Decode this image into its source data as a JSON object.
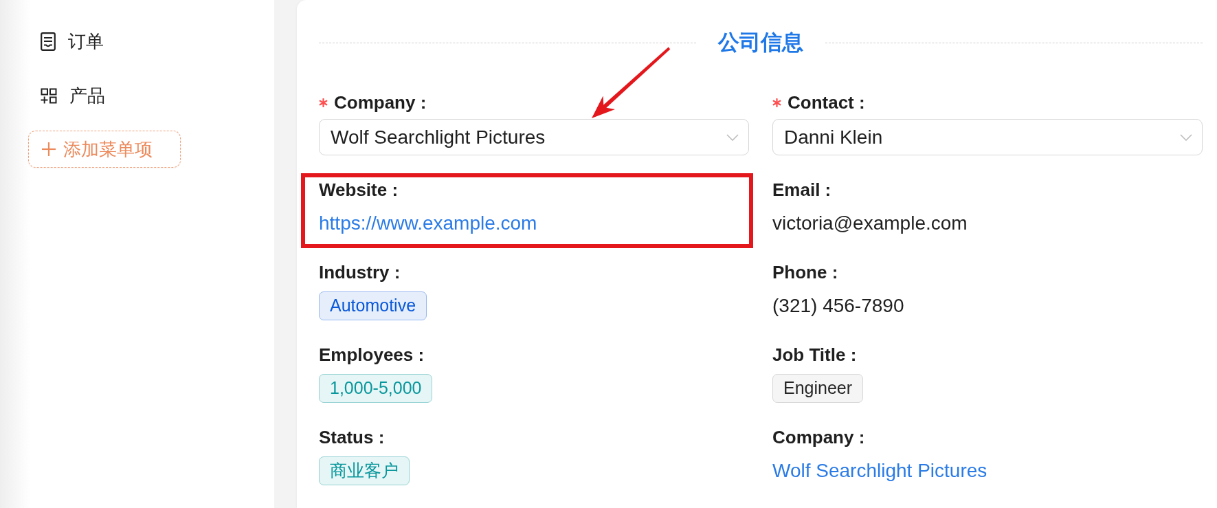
{
  "sidebar": {
    "items": [
      {
        "label": "订单",
        "selected": false
      },
      {
        "label": "产品",
        "selected": false
      }
    ],
    "add_button": {
      "label": "添加菜单项"
    }
  },
  "section": {
    "title": "公司信息"
  },
  "fields": [
    {
      "label": "Company :",
      "required": true,
      "kind": "select",
      "value": "Wolf Searchlight Pictures",
      "highlighted": false,
      "pointed_at": true
    },
    {
      "label": "Contact :",
      "required": true,
      "kind": "select",
      "value": "Danni Klein",
      "highlighted": false,
      "pointed_at": false
    },
    {
      "label": "Website :",
      "required": false,
      "kind": "link",
      "value": "https://www.example.com",
      "highlighted": true,
      "pointed_at": false
    },
    {
      "label": "Email :",
      "required": false,
      "kind": "text",
      "value": "victoria@example.com",
      "highlighted": false,
      "pointed_at": false
    },
    {
      "label": "Industry :",
      "required": false,
      "kind": "tag",
      "value": "Automotive",
      "color": "#0958d9",
      "highlighted": false,
      "pointed_at": false
    },
    {
      "label": "Phone :",
      "required": false,
      "kind": "text",
      "value": "(321) 456-7890",
      "highlighted": false,
      "pointed_at": false
    },
    {
      "label": "Employees :",
      "required": false,
      "kind": "tag",
      "value": "1,000-5,000",
      "color": "#08979c",
      "highlighted": false,
      "pointed_at": false
    },
    {
      "label": "Job Title :",
      "required": false,
      "kind": "tag",
      "value": "Engineer",
      "color": "#262626",
      "highlighted": false,
      "pointed_at": false
    },
    {
      "label": "Status :",
      "required": false,
      "kind": "tag",
      "value": "商业客户",
      "color": "#08979c",
      "highlighted": false,
      "pointed_at": false
    },
    {
      "label": "Company :",
      "required": false,
      "kind": "link",
      "value": "Wolf Searchlight Pictures",
      "highlighted": false,
      "pointed_at": false
    }
  ]
}
